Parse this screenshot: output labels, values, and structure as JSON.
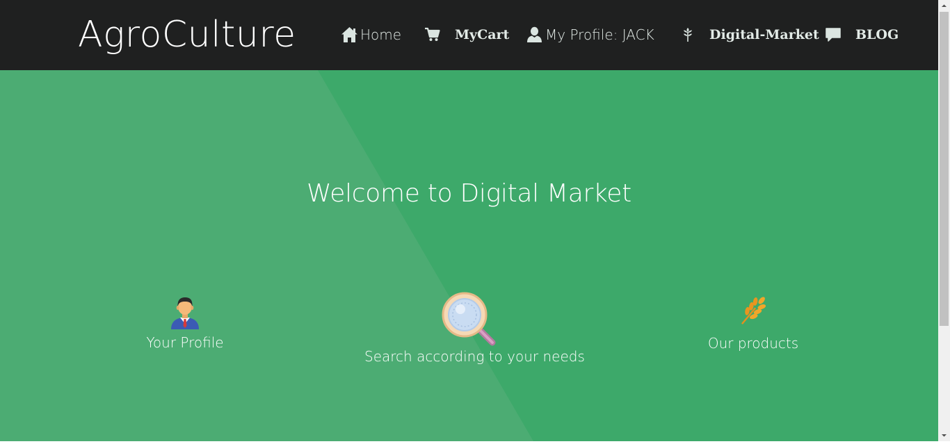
{
  "header": {
    "logo": "AgroCulture",
    "nav": {
      "home": {
        "label": "Home",
        "icon": "home-icon"
      },
      "cart": {
        "label": "MyCart",
        "icon": "cart-icon"
      },
      "profile": {
        "label": "My Profile: JACK",
        "icon": "user-icon"
      },
      "market": {
        "label": "Digital-Market",
        "icon": "grain-icon"
      },
      "blog": {
        "label": "BLOG",
        "icon": "comment-icon"
      }
    }
  },
  "hero": {
    "title": "Welcome to Digital Market",
    "features": [
      {
        "label": "Your Profile",
        "icon": "businessman-icon"
      },
      {
        "label": "Search according to your needs",
        "icon": "magnifier-icon"
      },
      {
        "label": "Our products",
        "icon": "wheat-icon"
      }
    ]
  },
  "colors": {
    "header_bg": "#1f2020",
    "hero_green": "#3da96a",
    "hero_green_light": "#4cac73",
    "text": "#ffffff"
  }
}
